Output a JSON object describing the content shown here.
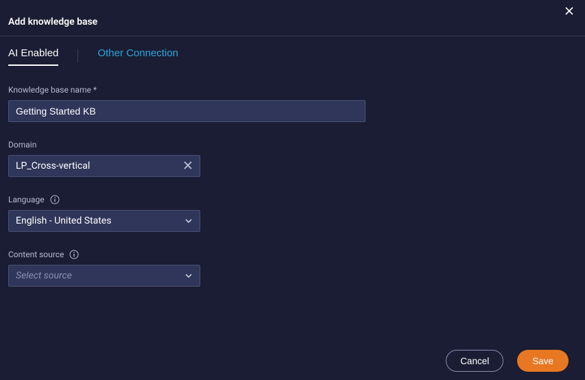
{
  "header": {
    "title": "Add knowledge base"
  },
  "tabs": {
    "ai_enabled": "AI Enabled",
    "other_connection": "Other Connection"
  },
  "form": {
    "name": {
      "label": "Knowledge base name *",
      "value": "Getting Started KB"
    },
    "domain": {
      "label": "Domain",
      "value": "LP_Cross-vertical"
    },
    "language": {
      "label": "Language",
      "value": "English - United States"
    },
    "content_source": {
      "label": "Content source",
      "placeholder": "Select source"
    }
  },
  "footer": {
    "cancel": "Cancel",
    "save": "Save"
  },
  "colors": {
    "accent": "#e87722",
    "link": "#2ba6df",
    "panel": "#303659",
    "background": "#1a1d33"
  }
}
